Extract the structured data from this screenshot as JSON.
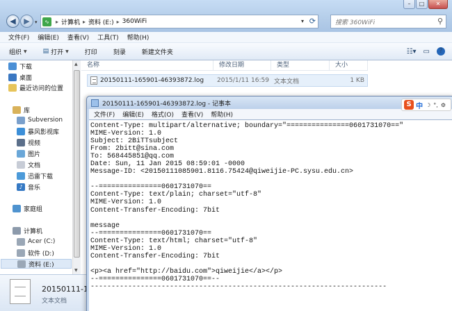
{
  "explorer": {
    "breadcrumb": [
      "计算机",
      "资料 (E:)",
      "360WiFi"
    ],
    "search_placeholder": "搜索 360WiFi",
    "menu": [
      "文件(F)",
      "编辑(E)",
      "查看(V)",
      "工具(T)",
      "帮助(H)"
    ],
    "toolbar": {
      "organize": "组织",
      "open": "打开",
      "print": "打印",
      "burn": "刻录",
      "new_folder": "新建文件夹"
    },
    "sidebar": {
      "favorites": [
        "下载",
        "桌面",
        "最近访问的位置"
      ],
      "libraries_header": "库",
      "libraries": [
        "Subversion",
        "暴风影视库",
        "视频",
        "图片",
        "文档",
        "迅雷下载",
        "音乐"
      ],
      "homegroup": "家庭组",
      "computer_header": "计算机",
      "drives": [
        "Acer (C:)",
        "软件 (D:)",
        "资料 (E:)"
      ],
      "selected": "资料 (E:)"
    },
    "columns": {
      "name": "名称",
      "modified": "修改日期",
      "type": "类型",
      "size": "大小"
    },
    "files": [
      {
        "name": "20150111-165901-46393872.log",
        "modified": "2015/1/11 16:59",
        "type": "文本文档",
        "size": "1 KB"
      }
    ],
    "details": {
      "name": "20150111-165901-46393872.log",
      "type": "文本文档"
    }
  },
  "notepad": {
    "title": "20150111-165901-46393872.log - 记事本",
    "menu": [
      "文件(F)",
      "编辑(E)",
      "格式(O)",
      "查看(V)",
      "帮助(H)"
    ],
    "ime": {
      "logo": "S",
      "mode": "中"
    },
    "content": "Content-Type: multipart/alternative; boundary=\"===============0601731070==\"\nMIME-Version: 1.0\nSubject: 2BiTTsubject\nFrom: 2bitt@sina.com\nTo: 568445851@qq.com\nDate: Sun, 11 Jan 2015 08:59:01 -0000\nMessage-ID: <20150111085901.8116.75424@qiweijie-PC.sysu.edu.cn>\n\n--===============0601731070==\nContent-Type: text/plain; charset=\"utf-8\"\nMIME-Version: 1.0\nContent-Transfer-Encoding: 7bit\n\nmessage\n--===============0601731070==\nContent-Type: text/html; charset=\"utf-8\"\nMIME-Version: 1.0\nContent-Transfer-Encoding: 7bit\n\n<p><a href=\"http://baidu.com\">qiweijie</a></p>\n--===============0601731070==--\n-----------------------------------------------------------------------"
  }
}
